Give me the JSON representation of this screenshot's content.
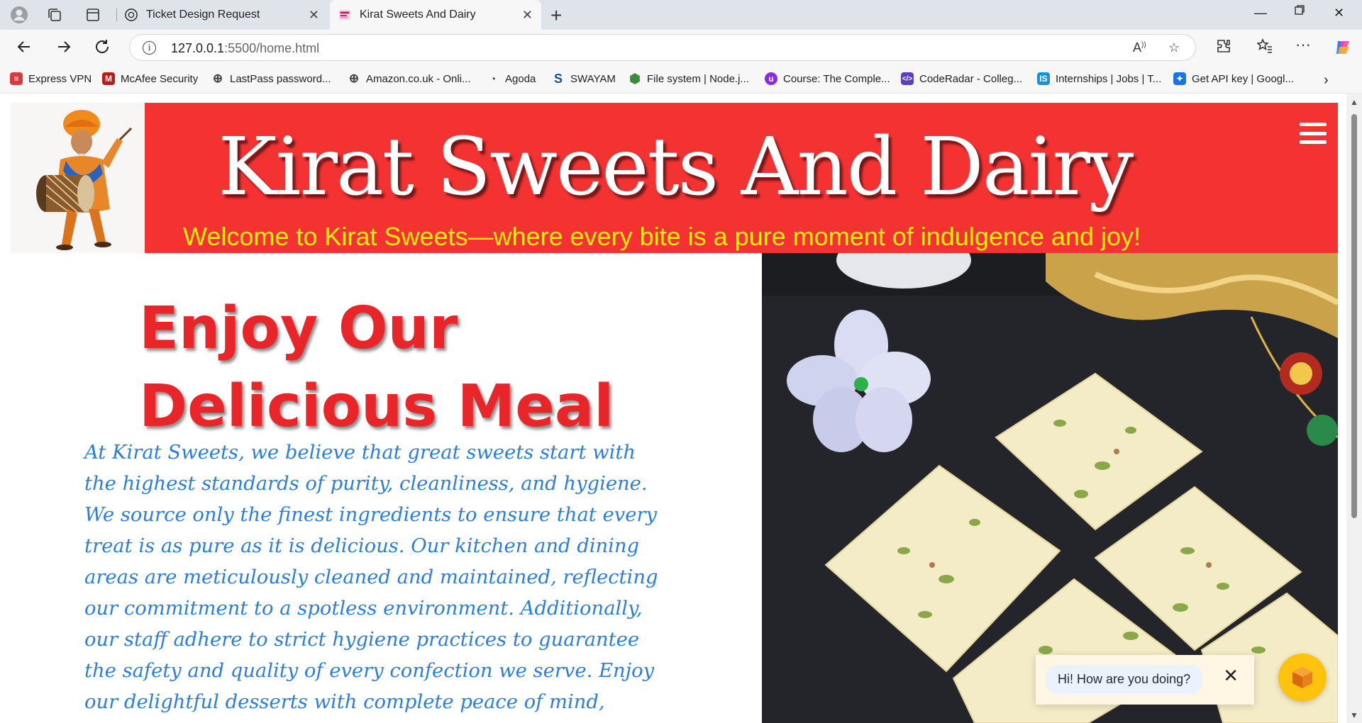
{
  "browser": {
    "tabs": [
      {
        "title": "Ticket Design Request",
        "icon": "openai-icon",
        "active": false
      },
      {
        "title": "Kirat Sweets And Dairy",
        "icon": "site-favicon",
        "active": true
      }
    ],
    "url": {
      "host": "127.0.0.1",
      "path": ":5500/home.html"
    },
    "bookmarks": [
      {
        "label": "Express VPN",
        "icon": "expressvpn-icon",
        "color": "#da3940"
      },
      {
        "label": "McAfee Security",
        "icon": "mcafee-icon",
        "color": "#c01818"
      },
      {
        "label": "LastPass password...",
        "icon": "globe-icon",
        "color": "#444444"
      },
      {
        "label": "Amazon.co.uk - Onli...",
        "icon": "globe-icon",
        "color": "#444444"
      },
      {
        "label": "Agoda",
        "icon": "agoda-icon",
        "color": "#333333"
      },
      {
        "label": "SWAYAM",
        "icon": "swayam-icon",
        "color": "#1f4e8c"
      },
      {
        "label": "File system | Node.j...",
        "icon": "nodejs-icon",
        "color": "#3c8c3c"
      },
      {
        "label": "Course: The Comple...",
        "icon": "udemy-icon",
        "color": "#8a2be2"
      },
      {
        "label": "CodeRadar - Colleg...",
        "icon": "coderadar-icon",
        "color": "#5a3fc0"
      },
      {
        "label": "Internships | Jobs | T...",
        "icon": "internshala-icon",
        "color": "#1c8fd9"
      },
      {
        "label": "Get API key | Googl...",
        "icon": "google-ai-icon",
        "color": "#1a73e8"
      }
    ]
  },
  "site": {
    "title": "Kirat Sweets And Dairy",
    "tagline": "Welcome to Kirat Sweets—where every bite is a pure moment of indulgence and joy!",
    "headline": "Enjoy Our Delicious Meal",
    "body": "At Kirat Sweets, we believe that great sweets start with the highest standards of purity, cleanliness, and hygiene. We source only the finest ingredients to ensure that every treat is as pure as it is delicious. Our kitchen and dining areas are meticulously cleaned and maintained, reflecting our commitment to a spotless environment. Additionally, our staff adhere to strict hygiene practices to guarantee the safety and quality of every confection we serve. Enjoy our delightful desserts with complete peace of mind, knowing that purity and cleanliness are our top priorities.",
    "colors": {
      "header": "#f43232",
      "tagline": "#ffee00",
      "headline": "#e8262a",
      "body": "#2a7ee0"
    }
  },
  "chat": {
    "greeting": "Hi! How are you doing?",
    "fab_color": "#ffc20e"
  }
}
